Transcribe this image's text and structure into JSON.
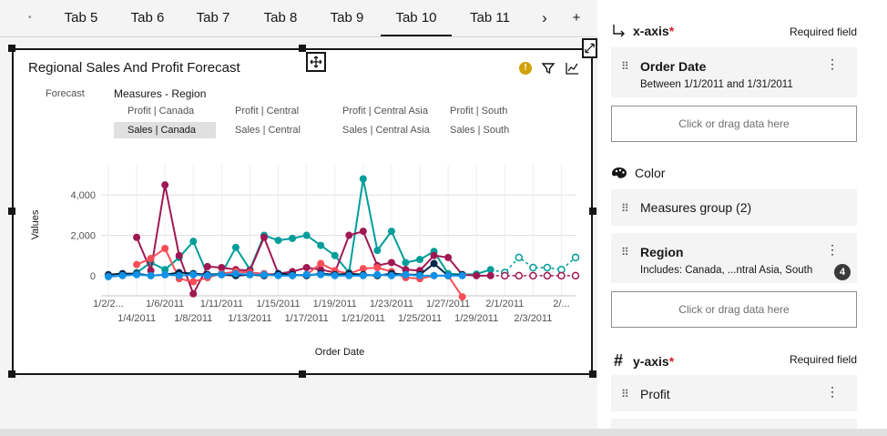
{
  "tabs": [
    {
      "label": "Tab 5",
      "active": false
    },
    {
      "label": "Tab 6",
      "active": false
    },
    {
      "label": "Tab 7",
      "active": false
    },
    {
      "label": "Tab 8",
      "active": false
    },
    {
      "label": "Tab 9",
      "active": false
    },
    {
      "label": "Tab 10",
      "active": true
    },
    {
      "label": "Tab 11",
      "active": false
    }
  ],
  "tab_controls": {
    "next": "›",
    "add": "+"
  },
  "widget": {
    "title": "Regional Sales And Profit Forecast",
    "legend": {
      "forecast_label": "Forecast",
      "title": "Measures - Region",
      "items": [
        {
          "label": "Profit | Canada",
          "selected": false
        },
        {
          "label": "Profit | Central",
          "selected": false
        },
        {
          "label": "Profit | Central Asia",
          "selected": false
        },
        {
          "label": "Profit | South",
          "selected": false
        },
        {
          "label": "Sales | Canada",
          "selected": true
        },
        {
          "label": "Sales | Central",
          "selected": false
        },
        {
          "label": "Sales | Central Asia",
          "selected": false
        },
        {
          "label": "Sales | South",
          "selected": false
        }
      ]
    }
  },
  "chart_data": {
    "type": "line",
    "title": "Regional Sales And Profit Forecast",
    "xlabel": "Order Date",
    "ylabel": "Values",
    "ylim": [
      -1000,
      5500
    ],
    "y_ticks": [
      "4,000",
      "2,000",
      "0"
    ],
    "y_tick_values": [
      4000,
      2000,
      0
    ],
    "x_ticks_top": [
      "1/2/2...",
      "1/6/2011",
      "1/11/2011",
      "1/15/2011",
      "1/19/2011",
      "1/23/2011",
      "1/27/2011",
      "2/1/2011",
      "2/..."
    ],
    "x_ticks_bottom": [
      "1/4/2011",
      "1/8/2011",
      "1/13/2011",
      "1/17/2011",
      "1/21/2011",
      "1/25/2011",
      "1/29/2011",
      "2/3/2011"
    ],
    "x_top_idx": [
      0,
      4,
      8,
      12,
      16,
      20,
      24,
      28,
      32
    ],
    "x_bottom_idx": [
      2,
      6,
      10,
      14,
      18,
      22,
      26,
      30
    ],
    "n_points": 34,
    "forecast_start": 28,
    "grid": true,
    "series": [
      {
        "name": "Sales | Central Asia",
        "color": "#009d9a",
        "values": [
          250,
          150,
          150,
          650,
          300,
          900,
          1700,
          50,
          100,
          1400,
          300,
          2000,
          1750,
          1850,
          2000,
          1500,
          1000,
          150,
          4800,
          1250,
          2200,
          650,
          800,
          1200,
          100,
          50,
          80,
          300,
          150,
          900,
          400,
          400,
          300,
          900
        ],
        "show_from": 2,
        "show_to": 33
      },
      {
        "name": "Sales | South",
        "color": "#9f1853",
        "values": [
          300,
          200,
          1900,
          250,
          4500,
          1000,
          -900,
          450,
          400,
          300,
          250,
          1900,
          100,
          200,
          400,
          300,
          150,
          2000,
          2200,
          500,
          650,
          300,
          250,
          1000,
          900,
          50,
          0,
          0,
          0,
          0,
          0,
          0,
          0,
          0
        ],
        "show_from": 2,
        "show_to": 33
      },
      {
        "name": "Sales | Canada",
        "color": "#fa4d56",
        "values": [
          350,
          300,
          550,
          850,
          1350,
          -150,
          -300,
          -100,
          100,
          200,
          150,
          100,
          50,
          0,
          50,
          600,
          250,
          100,
          350,
          400,
          200,
          -100,
          -150,
          0,
          0,
          -1050
        ],
        "show_from": 2,
        "show_to": 25
      },
      {
        "name": "Profit | Central Asia",
        "color": "#012749",
        "values": [
          50,
          100,
          100,
          0,
          50,
          150,
          100,
          50,
          50,
          0,
          50,
          0,
          100,
          50,
          0,
          100,
          50,
          100,
          50,
          0,
          100,
          50,
          50,
          600,
          0,
          50
        ],
        "show_from": 0,
        "show_to": 25
      },
      {
        "name": "Profit | Canada",
        "color": "#1192e8",
        "values": [
          -50,
          0,
          50,
          0,
          50,
          0,
          50,
          0,
          50,
          100,
          50,
          50,
          0,
          0,
          50,
          50,
          0,
          0,
          0,
          50,
          0,
          50,
          0,
          0,
          0,
          0
        ],
        "show_from": 0,
        "show_to": 25
      }
    ]
  },
  "panel": {
    "xaxis": {
      "title": "x-axis",
      "required_mark": "*",
      "required_label": "Required field",
      "slot_name": "Order Date",
      "slot_sub": "Between 1/1/2011 and 1/31/2011",
      "dropzone": "Click or drag data here"
    },
    "color": {
      "title": "Color",
      "measures_group": "Measures group (2)",
      "region_name": "Region",
      "region_sub": "Includes: Canada, ...ntral Asia, South",
      "region_count": "4",
      "dropzone": "Click or drag data here"
    },
    "yaxis": {
      "title": "y-axis",
      "required_mark": "*",
      "required_label": "Required field",
      "slot_name": "Profit"
    },
    "kebab": "⋮",
    "grip": "⠿"
  }
}
